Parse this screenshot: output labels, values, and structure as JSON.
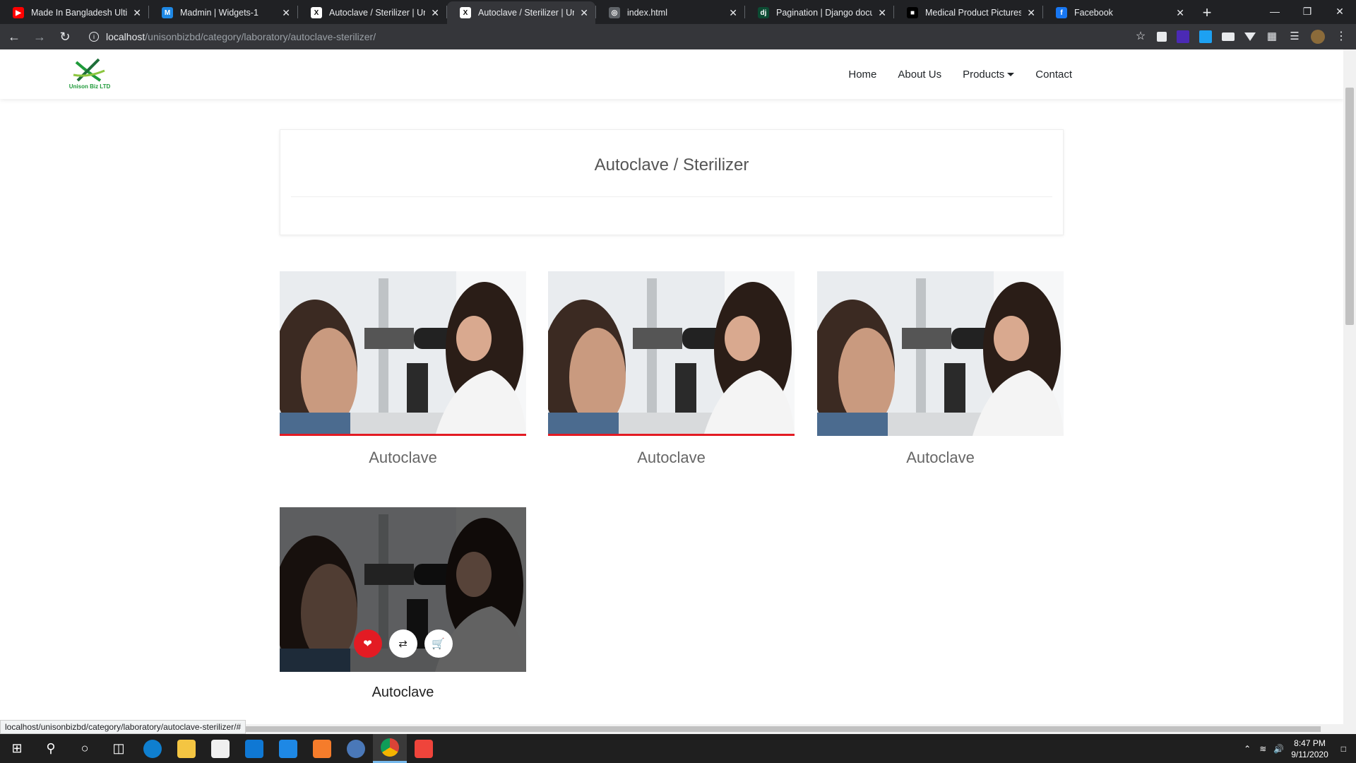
{
  "browser": {
    "tabs": [
      {
        "title": "Made In Bangladesh Ultima",
        "icon": "youtube-icon",
        "color": "#ff0000"
      },
      {
        "title": "Madmin | Widgets-1",
        "icon": "madmin-icon",
        "color": "#1e88e5"
      },
      {
        "title": "Autoclave / Sterilizer | Uniso",
        "icon": "unison-icon",
        "color": "#ffffff"
      },
      {
        "title": "Autoclave / Sterilizer | Uniso",
        "icon": "unison-icon",
        "color": "#ffffff",
        "active": true
      },
      {
        "title": "index.html",
        "icon": "globe-icon",
        "color": "#5f6368"
      },
      {
        "title": "Pagination | Django docume",
        "icon": "django-icon",
        "color": "#0c4b33"
      },
      {
        "title": "Medical Product Pictures | D",
        "icon": "picture-icon",
        "color": "#000000"
      },
      {
        "title": "Facebook",
        "icon": "facebook-icon",
        "color": "#1877f2"
      }
    ],
    "url_host": "localhost",
    "url_path": "/unisonbizbd/category/laboratory/autoclave-sterilizer/",
    "status_url": "localhost/unisonbizbd/category/laboratory/autoclave-sterilizer/#"
  },
  "site": {
    "logo_text": "Unison Biz LTD",
    "nav": [
      "Home",
      "About Us",
      "Products",
      "Contact"
    ],
    "page_title": "Autoclave / Sterilizer"
  },
  "products": [
    {
      "name": "Autoclave"
    },
    {
      "name": "Autoclave"
    },
    {
      "name": "Autoclave"
    },
    {
      "name": "Autoclave"
    }
  ],
  "taskbar": {
    "time": "8:47 PM",
    "date": "9/11/2020"
  },
  "colors": {
    "accent_red": "#e31b23",
    "brand_green": "#1f9a3a"
  }
}
